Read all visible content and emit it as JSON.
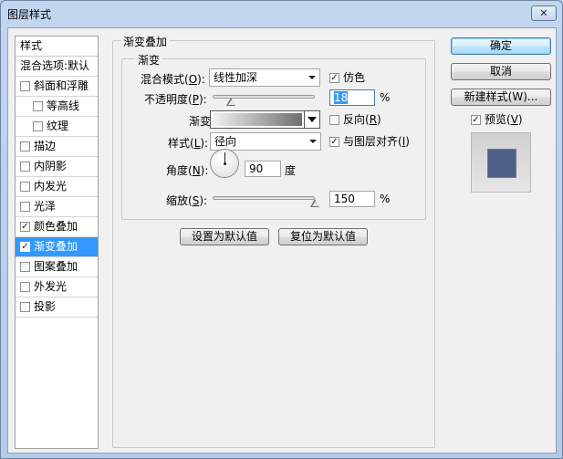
{
  "window": {
    "title": "图层样式",
    "close_glyph": "✕"
  },
  "sidebar": {
    "header": "样式",
    "items": [
      {
        "label": "混合选项:默认",
        "checked": null
      },
      {
        "label": "斜面和浮雕",
        "checked": false
      },
      {
        "label": "等高线",
        "checked": false,
        "sub": true
      },
      {
        "label": "纹理",
        "checked": false,
        "sub": true
      },
      {
        "label": "描边",
        "checked": false
      },
      {
        "label": "内阴影",
        "checked": false
      },
      {
        "label": "内发光",
        "checked": false
      },
      {
        "label": "光泽",
        "checked": false
      },
      {
        "label": "颜色叠加",
        "checked": true
      },
      {
        "label": "渐变叠加",
        "checked": true,
        "selected": true
      },
      {
        "label": "图案叠加",
        "checked": false
      },
      {
        "label": "外发光",
        "checked": false
      },
      {
        "label": "投影",
        "checked": false
      }
    ]
  },
  "panel": {
    "outer_title": "渐变叠加",
    "inner_title": "渐变",
    "blend_label": "混合模式(",
    "blend_key": "O",
    "blend_label_end": "):",
    "blend_value": "线性加深",
    "dither_label": "仿色",
    "dither_checked": true,
    "opacity_label": "不透明度(",
    "opacity_key": "P",
    "opacity_label_end": "):",
    "opacity_value": "18",
    "opacity_unit": "%",
    "gradient_label": "渐变:",
    "reverse_label": "反向(",
    "reverse_key": "R",
    "reverse_label_end": ")",
    "reverse_checked": false,
    "style_label": "样式(",
    "style_key": "L",
    "style_label_end": "):",
    "style_value": "径向",
    "align_label": "与图层对齐(",
    "align_key": "I",
    "align_label_end": ")",
    "align_checked": true,
    "angle_label": "角度(",
    "angle_key": "N",
    "angle_label_end": "):",
    "angle_value": "90",
    "angle_unit": "度",
    "scale_label": "缩放(",
    "scale_key": "S",
    "scale_label_end": "):",
    "scale_value": "150",
    "scale_unit": "%",
    "make_default": "设置为默认值",
    "reset_default": "复位为默认值",
    "opacity_fraction": 0.18,
    "scale_fraction": 1.0
  },
  "right": {
    "ok": "确定",
    "cancel": "取消",
    "new_style": "新建样式(W)...",
    "preview_label": "预览(",
    "preview_key": "V",
    "preview_label_end": ")",
    "preview_checked": true,
    "preview_color": "#4f6088"
  }
}
